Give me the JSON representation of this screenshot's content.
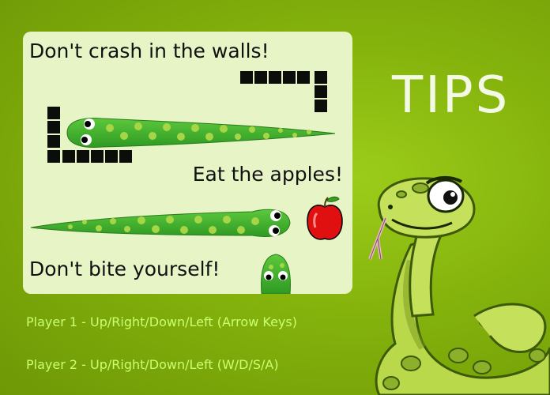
{
  "screen": {
    "title": "TIPS",
    "tips": {
      "walls": "Don't crash in the walls!",
      "apples": "Eat the apples!",
      "self": "Don't bite yourself!"
    },
    "controls": {
      "player1": "Player 1 - Up/Right/Down/Left (Arrow Keys)",
      "player2": "Player 2 - Up/Right/Down/Left (W/D/S/A)"
    }
  },
  "colors": {
    "background": "#84b20c",
    "panel": "#e6f4c6",
    "title": "#f4f9e6",
    "controls_text": "#c9ff70",
    "snake_body": "#44b62e",
    "snake_spots": "#a6d645",
    "wall_blocks": "#0a0d0a",
    "apple": "#e01010"
  },
  "icons": {
    "wall": "wall-blocks",
    "apple": "apple-icon",
    "mascot": "cartoon-snake-mascot"
  }
}
